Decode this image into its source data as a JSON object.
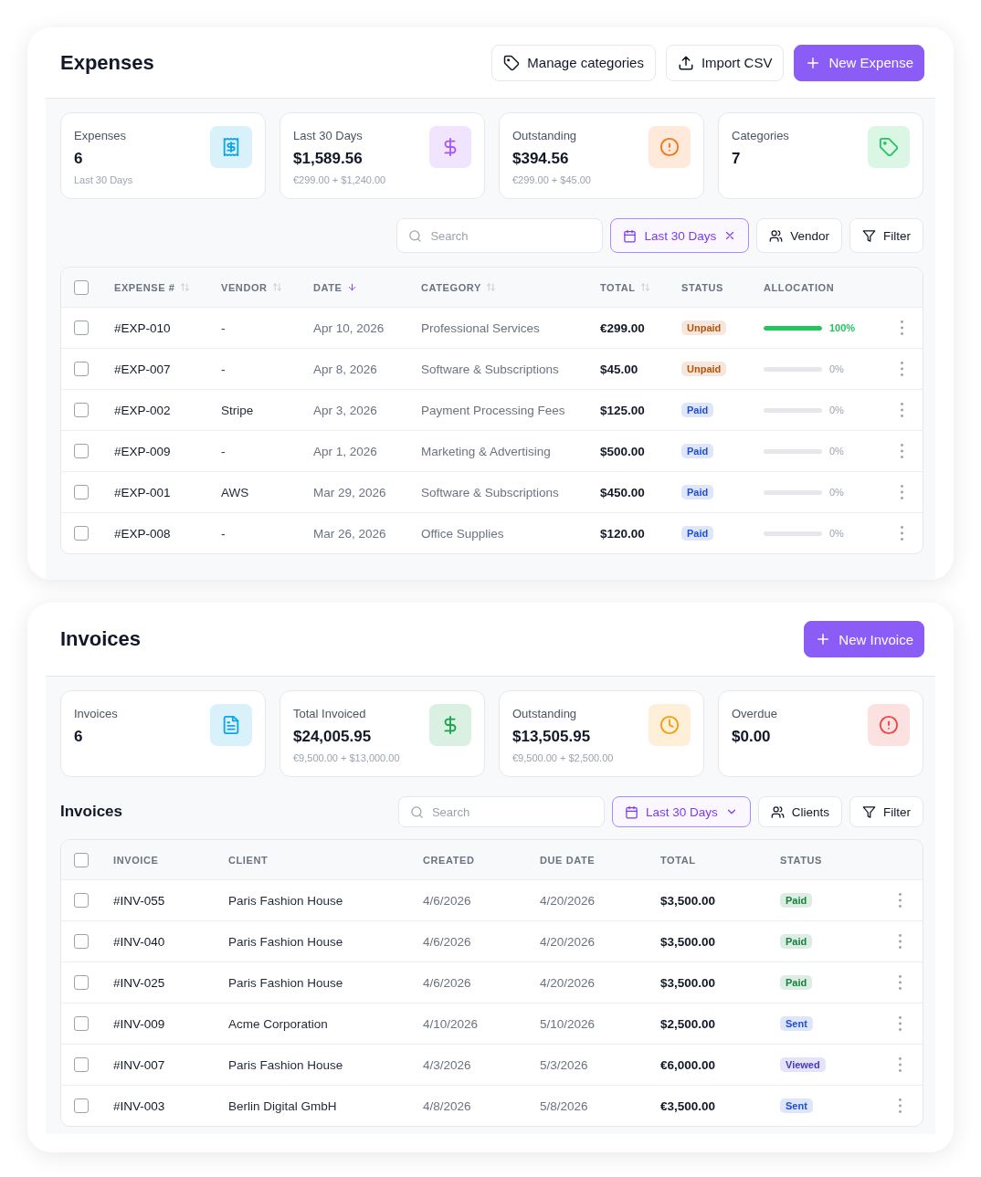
{
  "expenses": {
    "title": "Expenses",
    "actions": [
      {
        "kind": "outline",
        "label": "Manage categories"
      },
      {
        "kind": "outline",
        "label": "Import CSV"
      },
      {
        "kind": "primary",
        "label": "New Expense"
      }
    ],
    "stats": [
      {
        "label": "Expenses",
        "value": "6",
        "note": "Last 30 Days",
        "color": "#0ea5e9"
      },
      {
        "label": "Last 30 Days",
        "value": "$1,589.56",
        "note": "€299.00 + $1,240.00",
        "color": "#a855f7"
      },
      {
        "label": "Outstanding",
        "value": "$394.56",
        "note": "€299.00 + $45.00",
        "color": "#f97316"
      },
      {
        "label": "Categories",
        "value": "7",
        "color": "#22c55e"
      }
    ],
    "toolbar": {
      "search": {
        "placeholder": "Search"
      },
      "filters": [
        {
          "kind": "date",
          "label": "Last 30 Days",
          "selected": true,
          "clearable": true
        },
        {
          "kind": "people",
          "label": "Vendor",
          "selected": false
        },
        {
          "kind": "filter",
          "label": "Filter",
          "selected": false
        }
      ]
    },
    "table": {
      "checked": false,
      "columns": [
        {
          "label": "EXPENSE #",
          "kind": "id",
          "sortable": true,
          "sorted": false
        },
        {
          "label": "VENDOR",
          "kind": "text",
          "sortable": true,
          "sorted": false
        },
        {
          "label": "DATE",
          "kind": "muted",
          "sortable": true,
          "sorted": true
        },
        {
          "label": "CATEGORY",
          "kind": "muted",
          "sortable": true,
          "sorted": false
        },
        {
          "label": "TOTAL",
          "kind": "amount",
          "sortable": true,
          "sorted": false
        },
        {
          "label": "STATUS",
          "kind": "status",
          "sortable": false
        },
        {
          "label": "ALLOCATION",
          "kind": "allocation",
          "sortable": false
        }
      ],
      "rows": [
        {
          "checked": false,
          "cells": [
            "#EXP-010",
            "-",
            "Apr 10, 2026",
            "Professional Services",
            "€299.00"
          ],
          "status": {
            "label": "Unpaid",
            "color": "#b45309"
          },
          "allocation": {
            "level": 1,
            "reading": "100%"
          }
        },
        {
          "checked": false,
          "cells": [
            "#EXP-007",
            "-",
            "Apr 8, 2026",
            "Software & Subscriptions",
            "$45.00"
          ],
          "status": {
            "label": "Unpaid",
            "color": "#b45309"
          },
          "allocation": {
            "level": 0,
            "reading": "0%"
          }
        },
        {
          "checked": false,
          "cells": [
            "#EXP-002",
            "Stripe",
            "Apr 3, 2026",
            "Payment Processing Fees",
            "$125.00"
          ],
          "status": {
            "label": "Paid",
            "color": "#1d4ed8"
          },
          "allocation": {
            "level": 0,
            "reading": "0%"
          }
        },
        {
          "checked": false,
          "cells": [
            "#EXP-009",
            "-",
            "Apr 1, 2026",
            "Marketing & Advertising",
            "$500.00"
          ],
          "status": {
            "label": "Paid",
            "color": "#1d4ed8"
          },
          "allocation": {
            "level": 0,
            "reading": "0%"
          }
        },
        {
          "checked": false,
          "cells": [
            "#EXP-001",
            "AWS",
            "Mar 29, 2026",
            "Software & Subscriptions",
            "$450.00"
          ],
          "status": {
            "label": "Paid",
            "color": "#1d4ed8"
          },
          "allocation": {
            "level": 0,
            "reading": "0%"
          }
        },
        {
          "checked": false,
          "cells": [
            "#EXP-008",
            "-",
            "Mar 26, 2026",
            "Office Supplies",
            "$120.00"
          ],
          "status": {
            "label": "Paid",
            "color": "#1d4ed8"
          },
          "allocation": {
            "level": 0,
            "reading": "0%"
          }
        }
      ]
    }
  },
  "invoices": {
    "title": "Invoices",
    "actions": [
      {
        "kind": "primary",
        "label": "New Invoice"
      }
    ],
    "stats": [
      {
        "label": "Invoices",
        "value": "6",
        "color": "#0ea5e9"
      },
      {
        "label": "Total Invoiced",
        "value": "$24,005.95",
        "note": "€9,500.00 + $13,000.00",
        "color": "#16a34a"
      },
      {
        "label": "Outstanding",
        "value": "$13,505.95",
        "note": "€9,500.00 + $2,500.00",
        "color": "#f59e0b"
      },
      {
        "label": "Overdue",
        "value": "$0.00",
        "color": "#ef4444"
      }
    ],
    "toolbar": {
      "heading": "Invoices",
      "search": {
        "placeholder": "Search"
      },
      "filters": [
        {
          "kind": "date",
          "label": "Last 30 Days",
          "selected": true,
          "dropdown": true
        },
        {
          "kind": "people",
          "label": "Clients",
          "selected": false
        },
        {
          "kind": "filter",
          "label": "Filter",
          "selected": false
        }
      ]
    },
    "table": {
      "checked": false,
      "columns": [
        {
          "label": "INVOICE",
          "kind": "id"
        },
        {
          "label": "CLIENT",
          "kind": "text"
        },
        {
          "label": "CREATED",
          "kind": "muted"
        },
        {
          "label": "DUE DATE",
          "kind": "muted"
        },
        {
          "label": "TOTAL",
          "kind": "amount"
        },
        {
          "label": "STATUS",
          "kind": "status"
        }
      ],
      "rows": [
        {
          "checked": false,
          "cells": [
            "#INV-055",
            "Paris Fashion House",
            "4/6/2026",
            "4/20/2026",
            "$3,500.00"
          ],
          "status": {
            "label": "Paid",
            "color": "#15803d"
          }
        },
        {
          "checked": false,
          "cells": [
            "#INV-040",
            "Paris Fashion House",
            "4/6/2026",
            "4/20/2026",
            "$3,500.00"
          ],
          "status": {
            "label": "Paid",
            "color": "#15803d"
          }
        },
        {
          "checked": false,
          "cells": [
            "#INV-025",
            "Paris Fashion House",
            "4/6/2026",
            "4/20/2026",
            "$3,500.00"
          ],
          "status": {
            "label": "Paid",
            "color": "#15803d"
          }
        },
        {
          "checked": false,
          "cells": [
            "#INV-009",
            "Acme Corporation",
            "4/10/2026",
            "5/10/2026",
            "$2,500.00"
          ],
          "status": {
            "label": "Sent",
            "color": "#1d4ed8"
          }
        },
        {
          "checked": false,
          "cells": [
            "#INV-007",
            "Paris Fashion House",
            "4/3/2026",
            "5/3/2026",
            "€6,000.00"
          ],
          "status": {
            "label": "Viewed",
            "color": "#4338ca"
          }
        },
        {
          "checked": false,
          "cells": [
            "#INV-003",
            "Berlin Digital GmbH",
            "4/8/2026",
            "5/8/2026",
            "€3,500.00"
          ],
          "status": {
            "label": "Sent",
            "color": "#1d4ed8"
          }
        }
      ]
    }
  }
}
